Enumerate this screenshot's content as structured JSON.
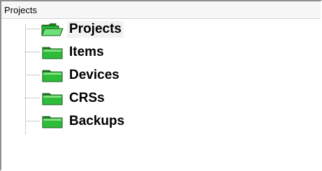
{
  "header": {
    "title": "Projects"
  },
  "tree": {
    "nodes": [
      {
        "label": "Projects",
        "icon": "open-folder-icon",
        "selected": true
      },
      {
        "label": "Items",
        "icon": "folder-icon",
        "selected": false
      },
      {
        "label": "Devices",
        "icon": "folder-icon",
        "selected": false
      },
      {
        "label": "CRSs",
        "icon": "folder-icon",
        "selected": false
      },
      {
        "label": "Backups",
        "icon": "folder-icon",
        "selected": false
      }
    ]
  },
  "colors": {
    "folder_green": "#2ebd3a",
    "folder_dark": "#1a7a22",
    "folder_light": "#7fe07f"
  }
}
